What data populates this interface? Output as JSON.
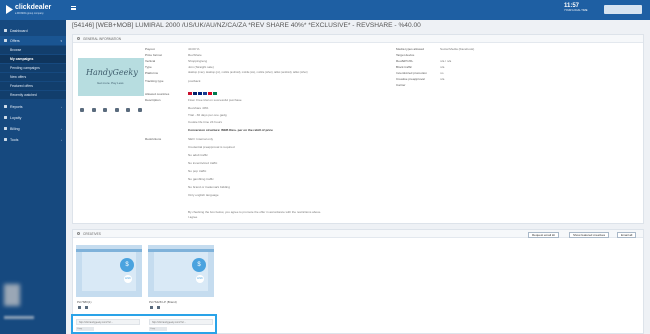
{
  "app": {
    "logo_text": "clickdealer",
    "logo_sub": "a MONDIA group company",
    "clock_time": "11:57",
    "clock_label": "YOUR LOCAL TIME"
  },
  "sidebar": {
    "items": [
      {
        "label": "Dashboard"
      },
      {
        "label": "Offers"
      },
      {
        "label": "Reports"
      },
      {
        "label": "Loyalty"
      },
      {
        "label": "Billing"
      },
      {
        "label": "Tools"
      }
    ],
    "offers_sub": [
      {
        "label": "Browse"
      },
      {
        "label": "My campaigns"
      },
      {
        "label": "Pending campaigns"
      },
      {
        "label": "New offers"
      },
      {
        "label": "Featured offers"
      },
      {
        "label": "Recently watched"
      }
    ]
  },
  "page": {
    "title": "[54146] [WEB+MOB] LUMIRAL 2000 /US/UK/AU/NZ/CA/ZA *REV SHARE 40%* *EXCLUSIVE* - REVSHARE - %40.00"
  },
  "general": {
    "header": "GENERAL INFORMATION",
    "brand_text": "HandyGeeky",
    "brand_tag": "Get more. Pay Less",
    "left_fields": [
      {
        "label": "Payout",
        "value": "40.00 %"
      },
      {
        "label": "Price format",
        "value": "RevShare"
      },
      {
        "label": "Vertical",
        "value": "Shopping/eng"
      },
      {
        "label": "Type",
        "value": "Join (Straight sale)"
      },
      {
        "label": "Platforms",
        "value": "desktop (mac), desktop (pc), mobile (android), mobile (ios), mobile (other), tablet (android), tablet (other)"
      },
      {
        "label": "Tracking type",
        "value": "postback"
      },
      {
        "label": "Allowed countries",
        "value": ""
      },
      {
        "label": "Description",
        "value": "Flow: Free trial on successful purchase"
      },
      {
        "label": "Restrictions",
        "value": "SEO: Internal only"
      }
    ],
    "description_lines": [
      "Revshare 40%",
      "Trial - 30 days per one gadg",
      "Cookie life time 24 hours",
      "Conversion structure: WEB Rev+ per on the rebill of price"
    ],
    "restriction_lines": [
      "Credential preapproval is required",
      "No adult traffic",
      "No incentivized traffic",
      "No pop traffic",
      "No gambling traffic",
      "No brand or trademark bidding",
      "Only english language"
    ],
    "right_fields": [
      {
        "label": "Media types allowed",
        "value": "Social Media (Facebook)"
      },
      {
        "label": "Target device",
        "value": ""
      },
      {
        "label": "Rev/EPC/FL",
        "value": "n/a / n/a"
      },
      {
        "label": "Block traffic",
        "value": "n/a"
      },
      {
        "label": "Incentivized promotion",
        "value": "no"
      },
      {
        "label": "Creative preapproval",
        "value": "n/a"
      },
      {
        "label": "Carrier",
        "value": ""
      }
    ],
    "agreement_text": "By checking the box below, you agree to promote the offer in accordance with the restrictions above.",
    "agreement_check": "I agree"
  },
  "creatives": {
    "header": "CREATIVES",
    "request_email": "Request email kit",
    "show_featured": "Show featured creatives",
    "email_all": "Email all",
    "thumb_circle_text": "$",
    "thumbs": [
      {
        "caption": "Pic7680(1)",
        "badge": "LINK"
      },
      {
        "caption": "Pic76428 LP (Brand)",
        "badge": "LINK"
      }
    ],
    "urls": [
      {
        "url": "http://clk.handygeeky.com/?a=...",
        "sub": "Copy"
      },
      {
        "url": "http://clk.handygeeky.com/?a=...",
        "sub": "Copy"
      }
    ]
  },
  "colors": {
    "topbar": "#1e5fa3",
    "sidebar": "#16497f",
    "highlight": "#2aa3e8"
  }
}
